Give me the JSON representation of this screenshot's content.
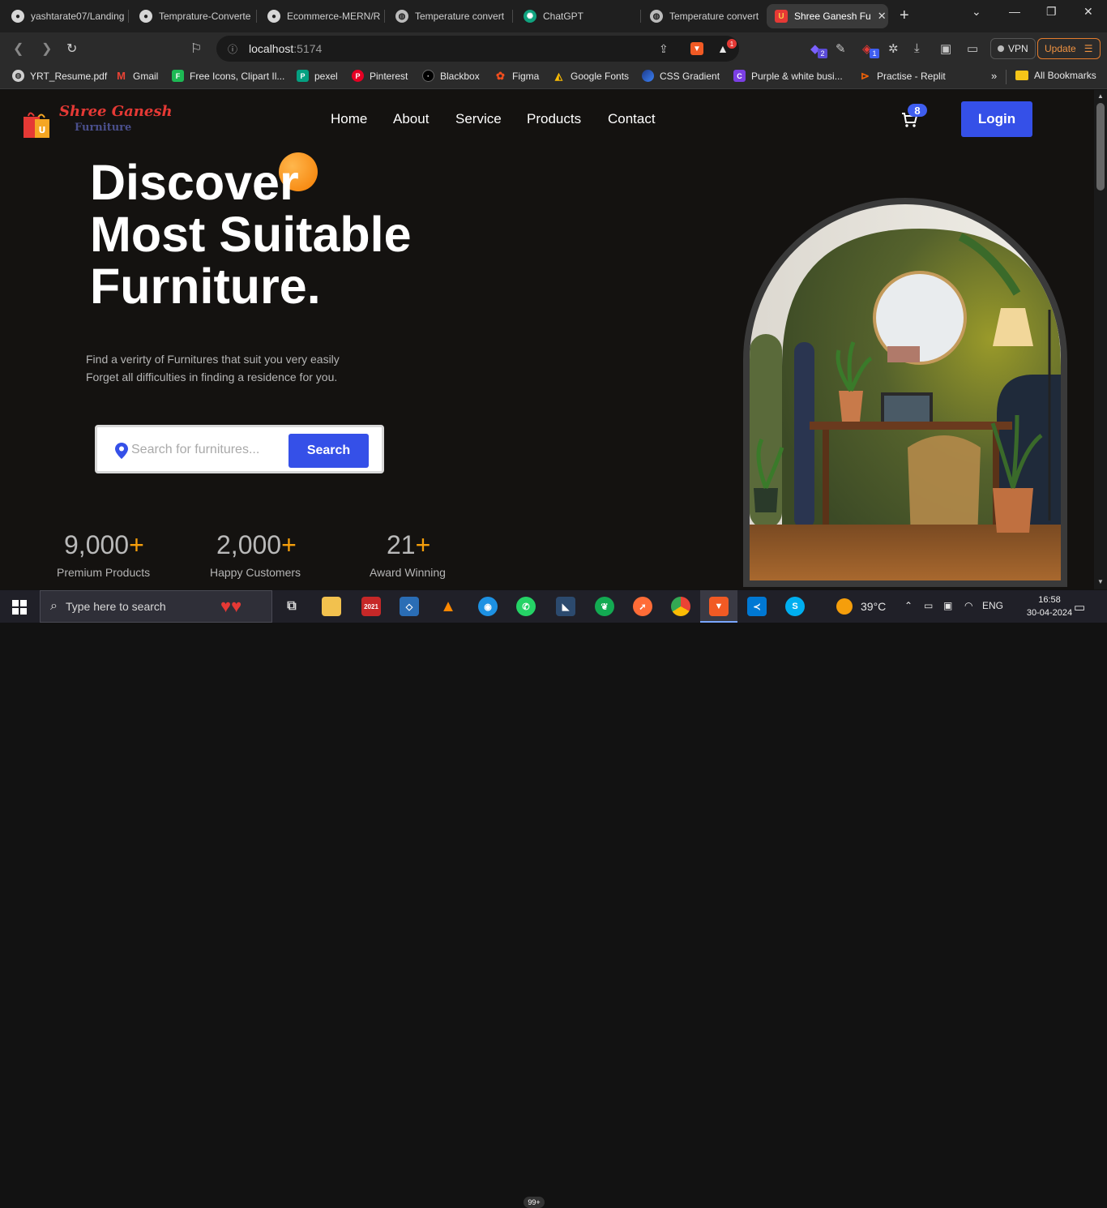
{
  "browser": {
    "tabs": [
      {
        "title": "yashtarate07/Landing",
        "icon": "github-icon"
      },
      {
        "title": "Temprature-Converte",
        "icon": "github-icon"
      },
      {
        "title": "Ecommerce-MERN/R",
        "icon": "github-icon"
      },
      {
        "title": "Temperature convert",
        "icon": "globe-icon"
      },
      {
        "title": "ChatGPT",
        "icon": "chatgpt-icon"
      },
      {
        "title": "Temperature convert",
        "icon": "globe-icon"
      },
      {
        "title": "Shree Ganesh Fu",
        "icon": "shopping-bag-icon",
        "active": true
      }
    ],
    "url_host": "localhost",
    "url_port": ":5174",
    "brave_badge": "1",
    "ext_badge_1": "2",
    "ext_badge_2": "1",
    "vpn_label": "VPN",
    "update_label": "Update",
    "bookmarks": [
      {
        "label": "YRT_Resume.pdf",
        "icon": "globe-icon"
      },
      {
        "label": "Gmail",
        "icon": "gmail-icon"
      },
      {
        "label": "Free Icons, Clipart Il...",
        "icon": "freeicons-icon"
      },
      {
        "label": "pexel",
        "icon": "pexels-icon"
      },
      {
        "label": "Pinterest",
        "icon": "pinterest-icon"
      },
      {
        "label": "Blackbox",
        "icon": "blackbox-icon"
      },
      {
        "label": "Figma",
        "icon": "figma-icon"
      },
      {
        "label": "Google Fonts",
        "icon": "google-fonts-icon"
      },
      {
        "label": "CSS Gradient",
        "icon": "css-gradient-icon"
      },
      {
        "label": "Purple & white busi...",
        "icon": "canva-icon"
      },
      {
        "label": "Practise - Replit",
        "icon": "replit-icon"
      }
    ],
    "more_bookmarks": "»",
    "all_bookmarks": "All Bookmarks"
  },
  "site": {
    "brand_line1": "Shree Ganesh",
    "brand_line2": "Furniture",
    "logo_letter": "U",
    "nav": [
      "Home",
      "About",
      "Service",
      "Products",
      "Contact"
    ],
    "cart_count": "8",
    "login_label": "Login",
    "hero_line1": "Discover",
    "hero_line2": "Most Suitable",
    "hero_line3": "Furniture.",
    "sub_line1": "Find a verirty of Furnitures that suit you very easily",
    "sub_line2": "Forget all difficulties in finding a residence for you.",
    "search_placeholder": "Search for furnitures...",
    "search_button": "Search",
    "stats": [
      {
        "value": "9,000",
        "plus": "+",
        "label": "Premium Products"
      },
      {
        "value": "2,000",
        "plus": "+",
        "label": "Happy Customers"
      },
      {
        "value": "21",
        "plus": "+",
        "label": "Award Winning"
      }
    ]
  },
  "taskbar": {
    "search_placeholder": "Type here to search",
    "weather": "39°C",
    "language": "ENG",
    "time": "16:58",
    "date": "30-04-2024",
    "whatsapp_badge": "99+",
    "sw_label": "2021"
  },
  "colors": {
    "accent_blue": "#3550e8",
    "accent_orange": "#f59e0b",
    "brand_red": "#e53935",
    "page_bg": "#141210"
  }
}
